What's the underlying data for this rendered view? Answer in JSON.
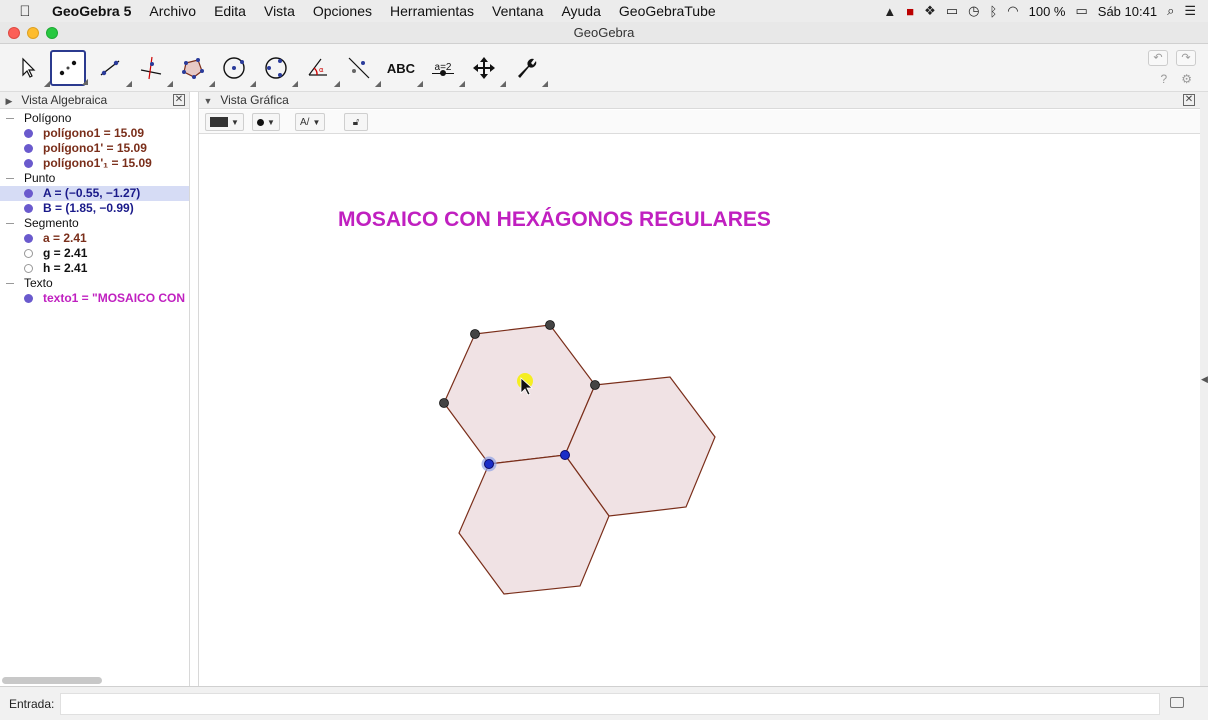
{
  "menubar": {
    "app": "GeoGebra 5",
    "items": [
      "Archivo",
      "Edita",
      "Vista",
      "Opciones",
      "Herramientas",
      "Ventana",
      "Ayuda",
      "GeoGebraTube"
    ],
    "status": {
      "battery": "100 %",
      "clock": "Sáb 10:41"
    }
  },
  "window": {
    "title": "GeoGebra"
  },
  "toolbar": {
    "tools": [
      {
        "name": "move-tool-icon"
      },
      {
        "name": "point-tool-icon"
      },
      {
        "name": "line-tool-icon"
      },
      {
        "name": "perpendicular-tool-icon"
      },
      {
        "name": "polygon-tool-icon"
      },
      {
        "name": "circle-tool-icon"
      },
      {
        "name": "conic-tool-icon"
      },
      {
        "name": "angle-tool-icon"
      },
      {
        "name": "reflect-tool-icon"
      },
      {
        "name": "text-tool-icon",
        "text": "ABC"
      },
      {
        "name": "slider-tool-icon",
        "text": "a=2"
      },
      {
        "name": "move-view-tool-icon"
      },
      {
        "name": "tools-wrench-icon"
      }
    ],
    "active_index": 1
  },
  "algebra": {
    "title": "Vista Algebraica",
    "categories": [
      {
        "label": "Polígono",
        "rows": [
          {
            "text": "polígono1 = 15.09",
            "color": "#7a2e1a"
          },
          {
            "text": "polígono1' = 15.09",
            "color": "#7a2e1a"
          },
          {
            "text": "polígono1'₁ = 15.09",
            "color": "#7a2e1a"
          }
        ]
      },
      {
        "label": "Punto",
        "rows": [
          {
            "text": "A = (−0.55, −1.27)",
            "color": "#1a1a8a",
            "selected": true
          },
          {
            "text": "B = (1.85, −0.99)",
            "color": "#1a1a8a"
          }
        ]
      },
      {
        "label": "Segmento",
        "rows": [
          {
            "text": "a = 2.41",
            "color": "#7a2e1a"
          },
          {
            "text": "g = 2.41",
            "color": "#111111",
            "hollow": true
          },
          {
            "text": "h = 2.41",
            "color": "#111111",
            "hollow": true
          }
        ]
      },
      {
        "label": "Texto",
        "rows": [
          {
            "text": "texto1 = \"MOSAICO CON",
            "color": "#c020c0"
          }
        ]
      }
    ]
  },
  "graphics": {
    "title": "Vista Gráfica",
    "heading": "MOSAICO CON HEXÁGONOS REGULARES",
    "heading_color": "#c020c0",
    "fill_color": "#f0e2e4",
    "edge_color": "#7a2e1a"
  },
  "stylebar": {
    "label_style_text": "A/⁄"
  },
  "input": {
    "label": "Entrada:"
  }
}
